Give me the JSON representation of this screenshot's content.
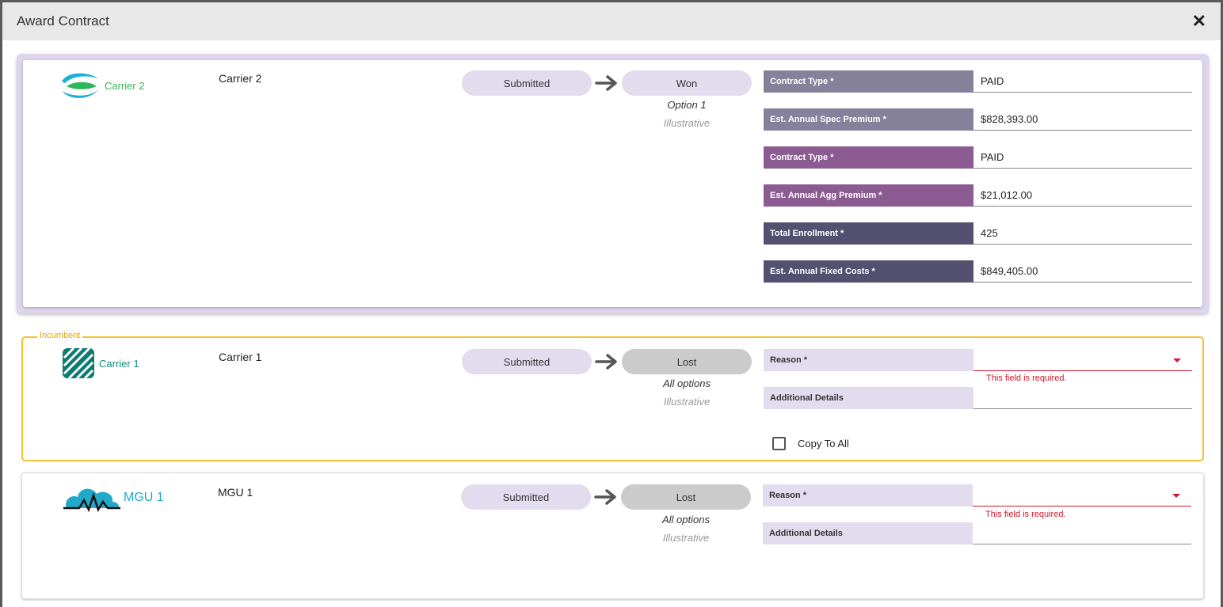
{
  "modal": {
    "title": "Award Contract",
    "close_icon": "close-icon"
  },
  "cards": [
    {
      "carrier": "Carrier 2",
      "logo_text": "Carrier 2",
      "status_from": "Submitted",
      "status_to": "Won",
      "option": "Option 1",
      "illustrative": "Illustrative",
      "fields": [
        {
          "label": "Contract Type *",
          "value": "PAID"
        },
        {
          "label": "Est. Annual Spec Premium *",
          "value": "$828,393.00"
        },
        {
          "label": "Contract Type *",
          "value": "PAID"
        },
        {
          "label": "Est. Annual Agg Premium *",
          "value": "$21,012.00"
        },
        {
          "label": "Total Enrollment *",
          "value": "425"
        },
        {
          "label": "Est. Annual Fixed Costs *",
          "value": "$849,405.00"
        }
      ]
    },
    {
      "tag": "Incumbent",
      "carrier": "Carrier 1",
      "logo_text": "Carrier 1",
      "status_from": "Submitted",
      "status_to": "Lost",
      "option": "All options",
      "illustrative": "Illustrative",
      "reason_label": "Reason *",
      "reason_value": "",
      "error": "This field is required.",
      "details_label": "Additional Details",
      "details_value": "",
      "copy_label": "Copy To All",
      "copy_checked": false
    },
    {
      "carrier": "MGU 1",
      "logo_text": "MGU 1",
      "status_from": "Submitted",
      "status_to": "Lost",
      "option": "All options",
      "illustrative": "Illustrative",
      "reason_label": "Reason *",
      "reason_value": "",
      "error": "This field is required.",
      "details_label": "Additional Details",
      "details_value": ""
    }
  ],
  "colors": {
    "won_card_bg": "#ddd6ec",
    "incumbent_border": "#f3c22e",
    "label_grey": "#85819b",
    "label_purple": "#8b5b91",
    "label_dark": "#54506f",
    "label_lavender": "#e3dcef",
    "error": "#d0152b"
  }
}
